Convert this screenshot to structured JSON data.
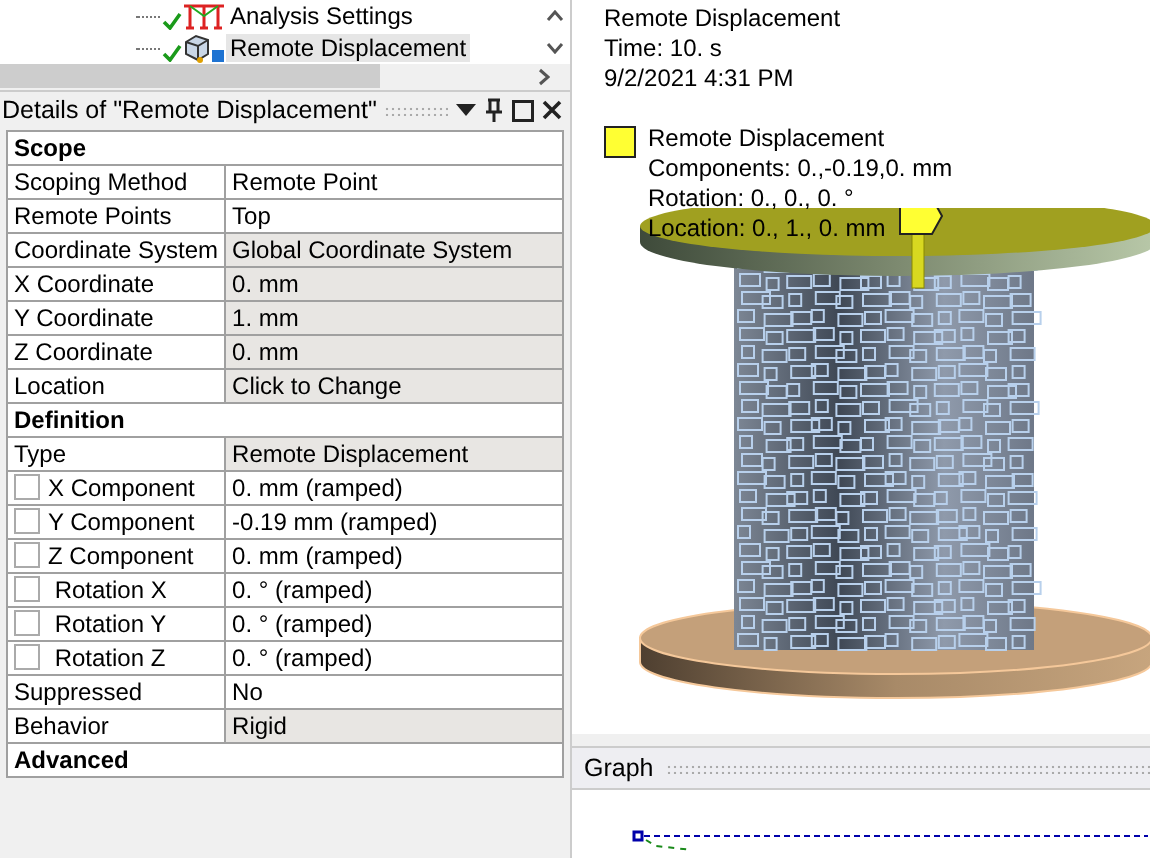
{
  "tree": {
    "items": [
      {
        "label": "Analysis Settings",
        "selected": false
      },
      {
        "label": "Remote Displacement",
        "selected": true
      }
    ]
  },
  "details": {
    "title": "Details of \"Remote Displacement\"",
    "rows": [
      {
        "kind": "header",
        "label": "Scope"
      },
      {
        "kind": "field",
        "label": "Scoping Method",
        "value": "Remote Point",
        "shaded": false
      },
      {
        "kind": "field",
        "label": "Remote Points",
        "value": "Top",
        "shaded": false
      },
      {
        "kind": "field",
        "label": "Coordinate System",
        "value": "Global Coordinate System",
        "shaded": true
      },
      {
        "kind": "field",
        "label": "X Coordinate",
        "value": "0. mm",
        "shaded": true
      },
      {
        "kind": "field",
        "label": "Y Coordinate",
        "value": "1. mm",
        "shaded": true
      },
      {
        "kind": "field",
        "label": "Z Coordinate",
        "value": "0. mm",
        "shaded": true
      },
      {
        "kind": "field",
        "label": "Location",
        "value": "Click to Change",
        "shaded": true
      },
      {
        "kind": "header",
        "label": "Definition"
      },
      {
        "kind": "field",
        "label": "Type",
        "value": "Remote Displacement",
        "shaded": true
      },
      {
        "kind": "checkbox",
        "label": "X Component",
        "value": "0. mm  (ramped)",
        "checked": false
      },
      {
        "kind": "checkbox",
        "label": "Y Component",
        "value": "-0.19 mm  (ramped)",
        "checked": false
      },
      {
        "kind": "checkbox",
        "label": "Z Component",
        "value": "0. mm  (ramped)",
        "checked": false
      },
      {
        "kind": "checkbox",
        "label": " Rotation X",
        "value": "0. °  (ramped)",
        "checked": false
      },
      {
        "kind": "checkbox",
        "label": " Rotation Y",
        "value": "0. °  (ramped)",
        "checked": false
      },
      {
        "kind": "checkbox",
        "label": " Rotation Z",
        "value": "0. °  (ramped)",
        "checked": false
      },
      {
        "kind": "field",
        "label": "Suppressed",
        "value": "No",
        "shaded": false
      },
      {
        "kind": "field",
        "label": "Behavior",
        "value": "Rigid",
        "shaded": true
      },
      {
        "kind": "header",
        "label": "Advanced"
      }
    ]
  },
  "viewport": {
    "info": [
      "Remote Displacement",
      "Time: 10. s",
      "9/2/2021 4:31 PM"
    ],
    "legend": {
      "color": "#ffff33",
      "lines": [
        "Remote Displacement",
        "Components: 0.,-0.19,0. mm",
        "Rotation: 0., 0., 0. °",
        "Location: 0., 1., 0. mm"
      ]
    }
  },
  "graph": {
    "title": "Graph"
  }
}
